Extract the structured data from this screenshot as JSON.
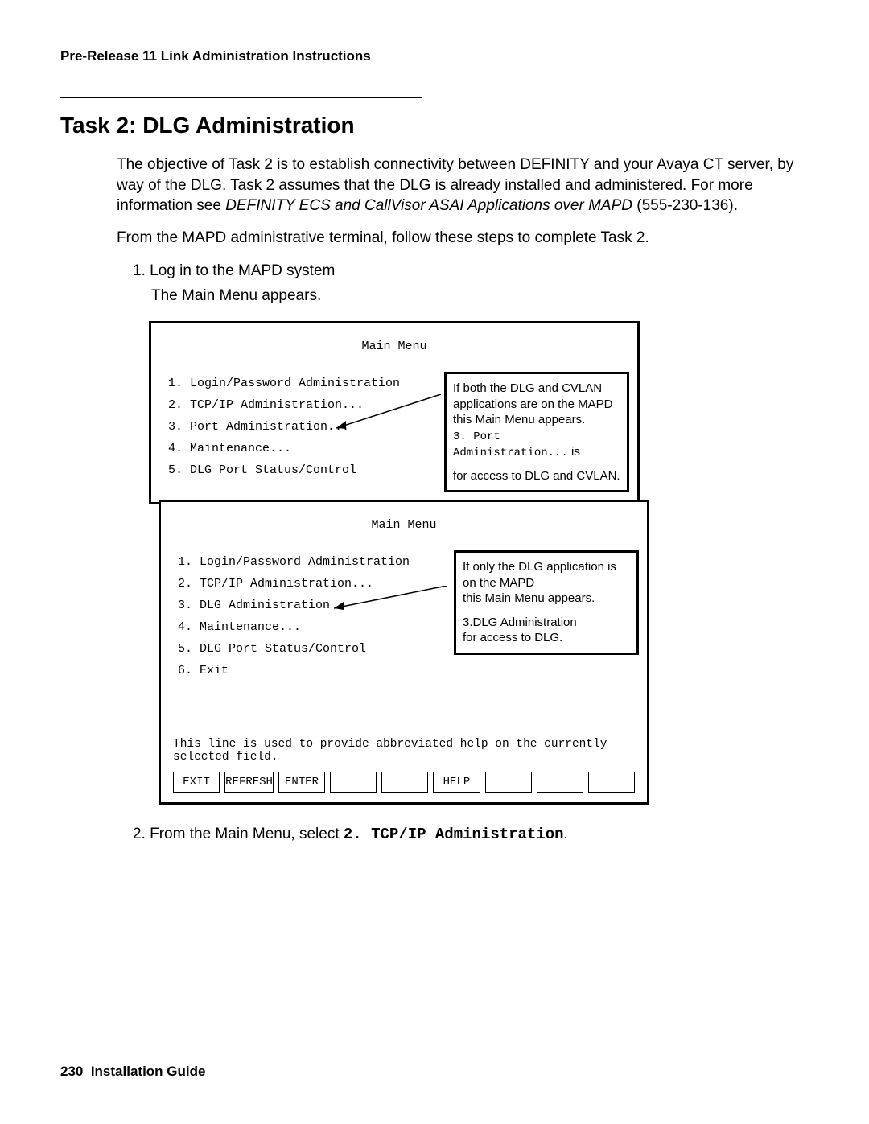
{
  "header": "Pre-Release 11 Link Administration Instructions",
  "title": "Task 2: DLG Administration",
  "para1_a": "The objective of Task 2 is to establish connectivity between DEFINITY and your Avaya CT server, by way of the DLG. Task 2 assumes that the DLG is already installed and administered. For more information see ",
  "para1_b": "DEFINITY ECS and CallVisor ASAI Applications over MAPD",
  "para1_c": " (555-230-136).",
  "para2": "From the MAPD administrative terminal, follow these steps to complete Task 2.",
  "step1_num": "1. ",
  "step1_text": "Log in to the MAPD system",
  "step1_follow": "The Main Menu appears.",
  "screen1": {
    "title": "Main Menu",
    "items": [
      "1.  Login/Password Administration",
      "2.  TCP/IP Administration...",
      "3.  Port Administration...",
      "4.  Maintenance...",
      "5.  DLG Port Status/Control"
    ],
    "callout_l1": "If both the DLG and CVLAN applications are on the MAPD this Main Menu appears.",
    "callout_l2a": "3. Port Administration...",
    "callout_l2b": " is",
    "callout_l3": "for access to DLG and CVLAN."
  },
  "screen2": {
    "title": "Main Menu",
    "items": [
      "1.  Login/Password Administration",
      "2.  TCP/IP Administration...",
      "3.  DLG Administration",
      "4.  Maintenance...",
      "5.  DLG Port Status/Control",
      "6.  Exit"
    ],
    "callout_l1": "If only the DLG application is on the MAPD",
    "callout_l2": "this Main Menu appears.",
    "callout_l3": "3.DLG Administration",
    "callout_l4": "for access to DLG.",
    "help_line": "This line is used to provide abbreviated help on the currently selected field.",
    "buttons": [
      "EXIT",
      "REFRESH",
      "ENTER",
      "",
      "",
      "HELP",
      "",
      "",
      ""
    ]
  },
  "step2_num": "2. ",
  "step2_a": "From the Main Menu, select ",
  "step2_b": "2. TCP/IP Administration",
  "step2_c": ".",
  "footer_page": "230",
  "footer_title": "Installation Guide"
}
